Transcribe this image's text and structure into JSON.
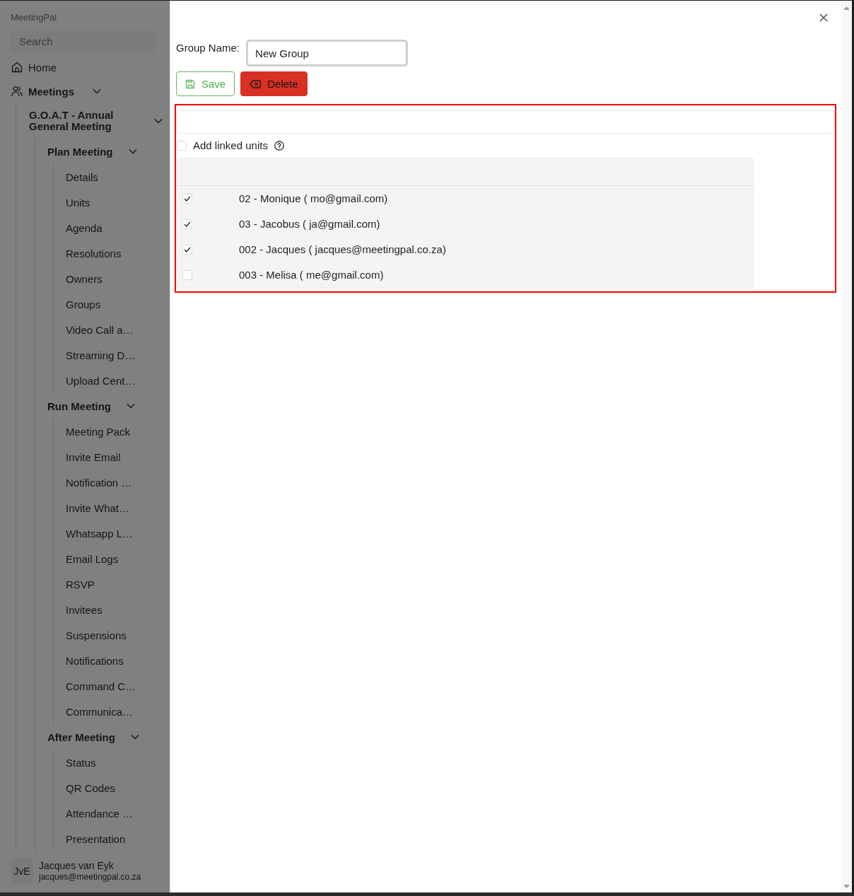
{
  "sidebar": {
    "brand": "MeetingPal",
    "search": {
      "placeholder": "Search"
    },
    "nav": [
      {
        "label": "Home"
      },
      {
        "label": "Meetings",
        "expanded": true,
        "children": [
          {
            "label": "G.O.A.T - Annual General Meeting",
            "expanded": true,
            "children": [
              {
                "label": "Plan Meeting",
                "expanded": true,
                "children": [
                  {
                    "label": "Details"
                  },
                  {
                    "label": "Units"
                  },
                  {
                    "label": "Agenda"
                  },
                  {
                    "label": "Resolutions"
                  },
                  {
                    "label": "Owners"
                  },
                  {
                    "label": "Groups"
                  },
                  {
                    "label": "Video Call a…"
                  },
                  {
                    "label": "Streaming D…"
                  },
                  {
                    "label": "Upload Cent…"
                  }
                ]
              },
              {
                "label": "Run Meeting",
                "expanded": true,
                "children": [
                  {
                    "label": "Meeting Pack"
                  },
                  {
                    "label": "Invite Email"
                  },
                  {
                    "label": "Notification …"
                  },
                  {
                    "label": "Invite What…"
                  },
                  {
                    "label": "Whatsapp L…"
                  },
                  {
                    "label": "Email Logs"
                  },
                  {
                    "label": "RSVP"
                  },
                  {
                    "label": "Invitees"
                  },
                  {
                    "label": "Suspensions"
                  },
                  {
                    "label": "Notifications"
                  },
                  {
                    "label": "Command C…"
                  },
                  {
                    "label": "Communica…"
                  }
                ]
              },
              {
                "label": "After Meeting",
                "expanded": true,
                "children": [
                  {
                    "label": "Status"
                  },
                  {
                    "label": "QR Codes"
                  },
                  {
                    "label": "Attendance …"
                  },
                  {
                    "label": "Presentation"
                  }
                ]
              }
            ]
          }
        ]
      }
    ],
    "user": {
      "initials": "JvE",
      "name": "Jacques van Eyk",
      "email": "jacques@meetingpal.co.za"
    }
  },
  "dialog": {
    "group_name": {
      "label": "Group Name:",
      "value": "New Group"
    },
    "buttons": [
      {
        "label": "Save",
        "kind": "save"
      },
      {
        "label": "Delete",
        "kind": "delete"
      }
    ],
    "linked_units": {
      "label": "Add linked units",
      "checked": false
    },
    "units": [
      {
        "label": "02 - Monique ( mo@gmail.com)",
        "checked": true
      },
      {
        "label": "03 - Jacobus ( ja@gmail.com)",
        "checked": true
      },
      {
        "label": "002 - Jacques ( jacques@meetingpal.co.za)",
        "checked": true
      },
      {
        "label": "003 - Melisa ( me@gmail.com)",
        "checked": false
      }
    ]
  }
}
